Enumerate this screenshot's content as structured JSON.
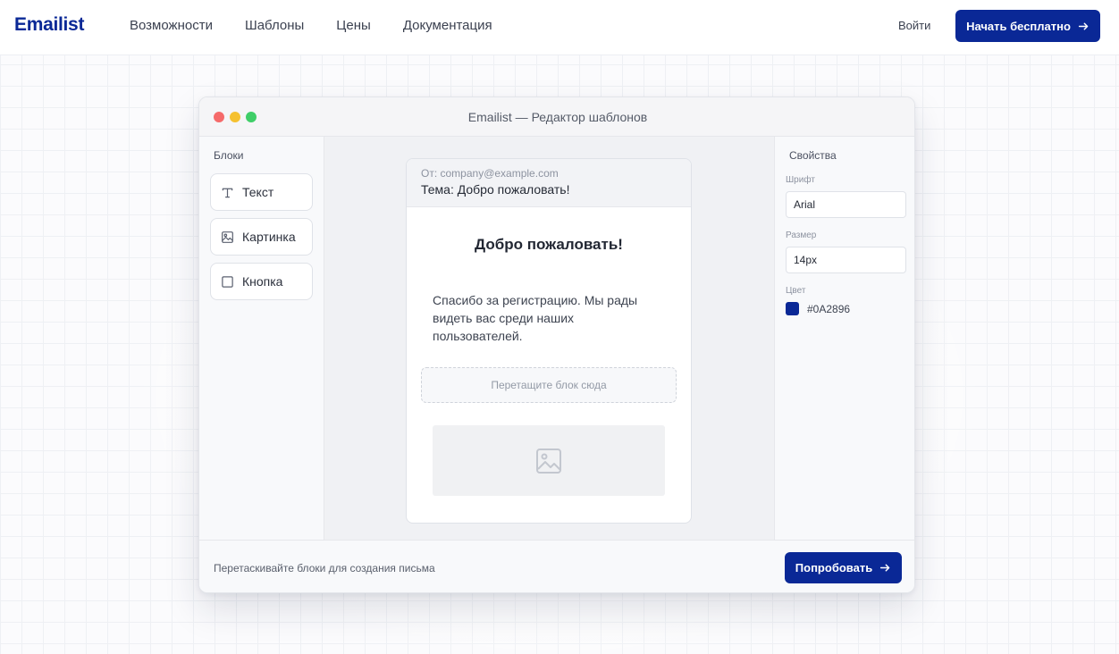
{
  "brand": {
    "logo": "Emailist",
    "accent": "#0A2896"
  },
  "nav": {
    "links": [
      "Возможности",
      "Шаблоны",
      "Цены",
      "Документация"
    ],
    "login": "Войти",
    "cta": "Начать бесплатно"
  },
  "editor": {
    "title": "Emailist — Редактор шаблонов",
    "blocks_title": "Блоки",
    "blocks": [
      {
        "label": "Текст",
        "icon": "text-icon"
      },
      {
        "label": "Картинка",
        "icon": "image-icon"
      },
      {
        "label": "Кнопка",
        "icon": "square-button-icon"
      }
    ],
    "email": {
      "from": "От: company@example.com",
      "subject": "Тема: Добро пожаловать!",
      "heading": "Добро пожаловать!",
      "body": "Спасибо за регистрацию. Мы рады видеть вас среди наших пользователей.",
      "dropzone": "Перетащите блок сюда"
    },
    "properties": {
      "title": "Свойства",
      "font_label": "Шрифт",
      "font_value": "Arial",
      "size_label": "Размер",
      "size_value": "14px",
      "color_label": "Цвет",
      "color_value": "#0A2896"
    },
    "footer": {
      "hint": "Перетаскивайте блоки для создания письма",
      "button": "Попробовать"
    }
  }
}
